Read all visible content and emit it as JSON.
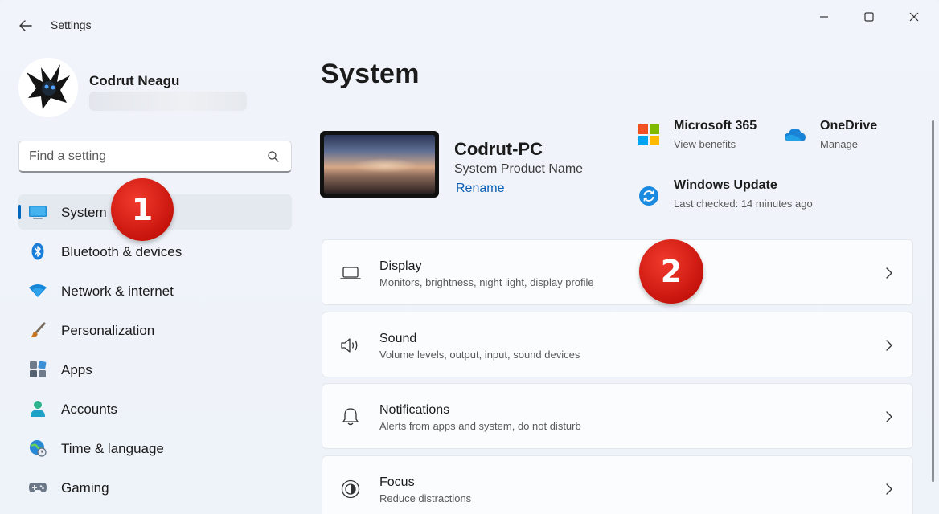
{
  "titlebar": {
    "app_title": "Settings",
    "back_icon": "arrow-left-icon",
    "controls": [
      "minimize-icon",
      "maximize-icon",
      "close-icon"
    ]
  },
  "profile": {
    "name": "Codrut Neagu"
  },
  "search": {
    "placeholder": "Find a setting",
    "icon": "search-icon"
  },
  "sidebar": {
    "items": [
      {
        "label": "System",
        "icon": "monitor-icon",
        "active": true
      },
      {
        "label": "Bluetooth & devices",
        "icon": "bluetooth-icon"
      },
      {
        "label": "Network & internet",
        "icon": "wifi-icon"
      },
      {
        "label": "Personalization",
        "icon": "brush-icon"
      },
      {
        "label": "Apps",
        "icon": "apps-icon"
      },
      {
        "label": "Accounts",
        "icon": "person-icon"
      },
      {
        "label": "Time & language",
        "icon": "globe-clock-icon"
      },
      {
        "label": "Gaming",
        "icon": "gamepad-icon"
      }
    ]
  },
  "annotations": {
    "badge_1": "1",
    "badge_2": "2"
  },
  "main": {
    "title": "System",
    "device": {
      "name": "Codrut-PC",
      "model": "System Product Name",
      "rename_label": "Rename"
    },
    "quick_links": [
      {
        "title": "Microsoft 365",
        "subtitle": "View benefits",
        "icon": "microsoft-logo-icon"
      },
      {
        "title": "OneDrive",
        "subtitle": "Manage",
        "icon": "cloud-icon"
      },
      {
        "title": "Windows Update",
        "subtitle": "Last checked: 14 minutes ago",
        "icon": "sync-icon"
      }
    ],
    "cards": [
      {
        "title": "Display",
        "subtitle": "Monitors, brightness, night light, display profile",
        "icon": "laptop-icon"
      },
      {
        "title": "Sound",
        "subtitle": "Volume levels, output, input, sound devices",
        "icon": "speaker-icon"
      },
      {
        "title": "Notifications",
        "subtitle": "Alerts from apps and system, do not disturb",
        "icon": "bell-icon"
      },
      {
        "title": "Focus",
        "subtitle": "Reduce distractions",
        "icon": "focus-icon"
      }
    ]
  },
  "colors": {
    "accent": "#0067c0",
    "link": "#0a5fb4",
    "annotation_red": "#d9190f"
  }
}
